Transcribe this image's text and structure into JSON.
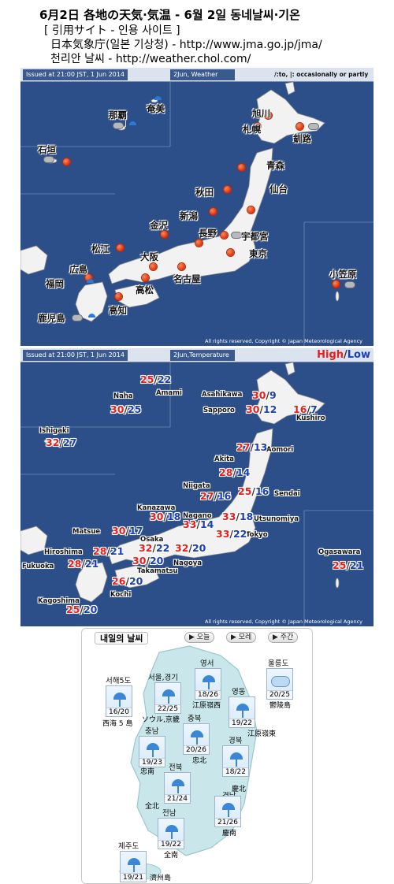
{
  "header": {
    "line1": "6月2日 各地の天気·気温 - 6월 2일 동네날씨·기온",
    "line2": "[ 引用サイト - 인용 사이트 ]",
    "line3_prefix": "日本気象庁(일본 기상청) - ",
    "line3_url": "http://www.jma.go.jp/jma/",
    "line4_prefix": "천리안 날씨 - ",
    "line4_url": "http://weather.chol.com/"
  },
  "colors": {
    "sea": "#2c4f8a",
    "land": "#f2f2f2",
    "high": "#e5201c",
    "low": "#1a3db8",
    "korea_land": "#c9e6ea"
  },
  "weather_map": {
    "issued": "Issued at 21:00 JST, 1 Jun 2014",
    "panel_title": "2Jun, Weather",
    "legend": "/:to, |: occasionally or partly",
    "copyright": "All rights reserved, Copyright © Japan Meteorological Agency",
    "cities": [
      "奄美",
      "那覇",
      "石垣",
      "旭川",
      "札幌",
      "釧路",
      "青森",
      "秋田",
      "仙台",
      "新潟",
      "金沢",
      "長野",
      "宇都宮",
      "松江",
      "大阪",
      "東京",
      "広島",
      "小笠原",
      "福岡",
      "高松",
      "名古屋",
      "鹿児島",
      "高知"
    ],
    "icons": [
      {
        "name": "奄美",
        "icon": "sun-icon"
      },
      {
        "name": "那覇",
        "icon": "cloud-icon"
      },
      {
        "name": "石垣",
        "icon": "cloud-icon"
      },
      {
        "name": "旭川",
        "icon": "sun-icon"
      },
      {
        "name": "札幌",
        "icon": "sun-icon"
      },
      {
        "name": "釧路",
        "icon": "sun-icon"
      },
      {
        "name": "小笠原",
        "icon": "cloud-icon"
      }
    ]
  },
  "temp_map": {
    "issued": "Issued at 21:00 JST, 1 Jun 2014",
    "panel_title": "2Jun,Temperature",
    "high_label": "High",
    "sep": "/",
    "low_label": "Low",
    "copyright": "All rights reserved, Copyright © Japan Meteorological Agency",
    "cities": [
      "Amami",
      "Naha",
      "Ishigaki",
      "Asahikawa",
      "Sapporo",
      "Kushiro",
      "Aomori",
      "Akita",
      "Niigata",
      "Sendai",
      "Kanazawa",
      "Nagano",
      "Utsunomiya",
      "Matsue",
      "Osaka",
      "Tokyo",
      "Hiroshima",
      "Fukuoka",
      "Takamatsu",
      "Nagoya",
      "Kochi",
      "Kagoshima",
      "Ogasawara"
    ],
    "readings": [
      {
        "city": "Amami",
        "high": "25",
        "low": "22"
      },
      {
        "city": "Naha",
        "high": "30",
        "low": "25"
      },
      {
        "city": "Ishigaki",
        "high": "32",
        "low": "27"
      },
      {
        "city": "Asahikawa",
        "high": "30",
        "low": "9"
      },
      {
        "city": "Sapporo",
        "high": "30",
        "low": "12"
      },
      {
        "city": "Kushiro",
        "high": "16",
        "low": "7"
      },
      {
        "city": "Aomori",
        "high": "27",
        "low": "13"
      },
      {
        "city": "Akita",
        "high": "28",
        "low": "14"
      },
      {
        "city": "Niigata",
        "high": "27",
        "low": "16"
      },
      {
        "city": "Sendai",
        "high": "25",
        "low": "16"
      },
      {
        "city": "Kanazawa",
        "high": "30",
        "low": "18"
      },
      {
        "city": "Nagano",
        "high": "33",
        "low": "14"
      },
      {
        "city": "Utsunomiya",
        "high": "33",
        "low": "18"
      },
      {
        "city": "Matsue",
        "high": "30",
        "low": "17"
      },
      {
        "city": "Tokyo",
        "high": "33",
        "low": "22"
      },
      {
        "city": "Osaka",
        "high": "32",
        "low": "22"
      },
      {
        "city": "Nagoya",
        "high": "32",
        "low": "20"
      },
      {
        "city": "Hiroshima",
        "high": "28",
        "low": "21"
      },
      {
        "city": "Fukuoka",
        "high": "28",
        "low": "21"
      },
      {
        "city": "Takamatsu",
        "high": "30",
        "low": "20"
      },
      {
        "city": "Kochi",
        "high": "26",
        "low": "20"
      },
      {
        "city": "Kagoshima",
        "high": "25",
        "low": "20"
      },
      {
        "city": "Ogasawara",
        "high": "25",
        "low": "21"
      }
    ]
  },
  "korea_widget": {
    "title": "내일의 날씨",
    "tabs": [
      "▶ 오늘",
      "▶ 모레",
      "▶ 주간"
    ],
    "regions": [
      {
        "ko": "영서",
        "temp": "18/26",
        "sub": "江原嶺西",
        "icon": "umbrella-icon"
      },
      {
        "ko": "울릉도",
        "temp": "20/25",
        "sub": "鬱陵島",
        "icon": "cloud-icon"
      },
      {
        "ko": "서해5도",
        "temp": "16/20",
        "sub": "西海 5 島",
        "icon": "umbrella-icon"
      },
      {
        "ko": "서울,경기",
        "temp": "22/25",
        "sub": "ソウル,京畿",
        "icon": "umbrella-icon"
      },
      {
        "ko": "영동",
        "temp": "19/22",
        "sub": "江原嶺東",
        "icon": "umbrella-icon"
      },
      {
        "ko": "충북",
        "temp": "20/26",
        "sub": "忠北",
        "icon": "umbrella-icon"
      },
      {
        "ko": "충남",
        "temp": "19/23",
        "sub": "忠南",
        "icon": "umbrella-icon"
      },
      {
        "ko": "경북",
        "temp": "18/22",
        "sub": "慶北",
        "icon": "umbrella-icon"
      },
      {
        "ko": "전북",
        "temp": "21/24",
        "sub": "全北",
        "icon": "umbrella-icon"
      },
      {
        "ko": "경남",
        "temp": "21/26",
        "sub": "慶南",
        "icon": "umbrella-icon"
      },
      {
        "ko": "전남",
        "temp": "19/22",
        "sub": "全南",
        "icon": "umbrella-icon"
      },
      {
        "ko": "제주도",
        "temp": "19/21",
        "sub": "濟州島",
        "icon": "umbrella-icon"
      }
    ]
  }
}
